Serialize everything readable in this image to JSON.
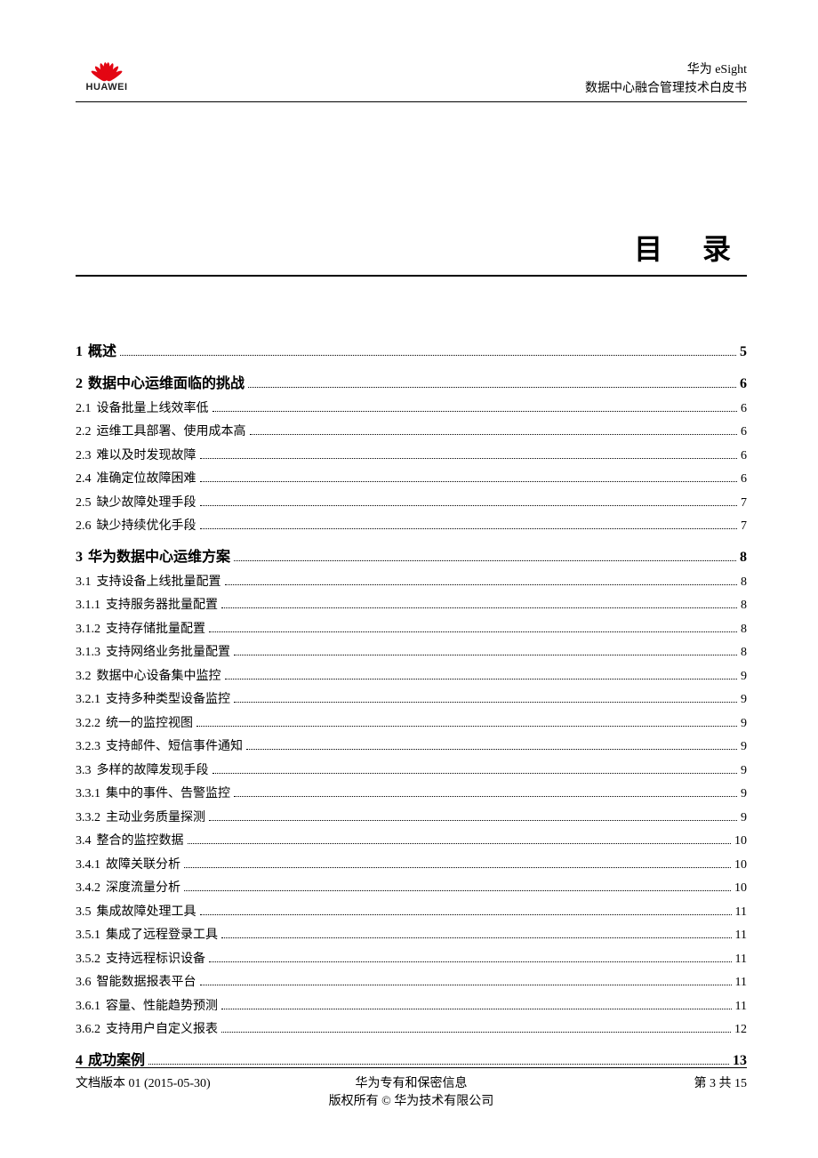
{
  "header": {
    "logo_text": "HUAWEI",
    "line1": "华为 eSight",
    "line2": "数据中心融合管理技术白皮书"
  },
  "title": "目 录",
  "toc": [
    {
      "level": 1,
      "num": "1",
      "label": "概述",
      "page": "5"
    },
    {
      "level": 1,
      "num": "2",
      "label": "数据中心运维面临的挑战",
      "page": "6"
    },
    {
      "level": 2,
      "num": "2.1",
      "label": "设备批量上线效率低",
      "page": "6"
    },
    {
      "level": 2,
      "num": "2.2",
      "label": "运维工具部署、使用成本高",
      "page": "6"
    },
    {
      "level": 2,
      "num": "2.3",
      "label": "难以及时发现故障",
      "page": "6"
    },
    {
      "level": 2,
      "num": "2.4",
      "label": "准确定位故障困难",
      "page": "6"
    },
    {
      "level": 2,
      "num": "2.5",
      "label": "缺少故障处理手段",
      "page": "7"
    },
    {
      "level": 2,
      "num": "2.6",
      "label": "缺少持续优化手段",
      "page": "7"
    },
    {
      "level": 1,
      "num": "3",
      "label": "华为数据中心运维方案",
      "page": "8"
    },
    {
      "level": 2,
      "num": "3.1",
      "label": "支持设备上线批量配置",
      "page": "8"
    },
    {
      "level": 3,
      "num": "3.1.1",
      "label": "支持服务器批量配置",
      "page": "8"
    },
    {
      "level": 3,
      "num": "3.1.2",
      "label": "支持存储批量配置",
      "page": "8"
    },
    {
      "level": 3,
      "num": "3.1.3",
      "label": "支持网络业务批量配置",
      "page": "8"
    },
    {
      "level": 2,
      "num": "3.2",
      "label": "数据中心设备集中监控",
      "page": "9"
    },
    {
      "level": 3,
      "num": "3.2.1",
      "label": "支持多种类型设备监控",
      "page": "9"
    },
    {
      "level": 3,
      "num": "3.2.2",
      "label": "统一的监控视图",
      "page": "9"
    },
    {
      "level": 3,
      "num": "3.2.3",
      "label": "支持邮件、短信事件通知",
      "page": "9"
    },
    {
      "level": 2,
      "num": "3.3",
      "label": "多样的故障发现手段",
      "page": "9"
    },
    {
      "level": 3,
      "num": "3.3.1",
      "label": "集中的事件、告警监控",
      "page": "9"
    },
    {
      "level": 3,
      "num": "3.3.2",
      "label": "主动业务质量探测",
      "page": "9"
    },
    {
      "level": 2,
      "num": "3.4",
      "label": "整合的监控数据",
      "page": "10"
    },
    {
      "level": 3,
      "num": "3.4.1",
      "label": "故障关联分析",
      "page": "10"
    },
    {
      "level": 3,
      "num": "3.4.2",
      "label": "深度流量分析",
      "page": "10"
    },
    {
      "level": 2,
      "num": "3.5",
      "label": "集成故障处理工具",
      "page": "11"
    },
    {
      "level": 3,
      "num": "3.5.1",
      "label": "集成了远程登录工具",
      "page": "11"
    },
    {
      "level": 3,
      "num": "3.5.2",
      "label": "支持远程标识设备",
      "page": "11"
    },
    {
      "level": 2,
      "num": "3.6",
      "label": "智能数据报表平台",
      "page": "11"
    },
    {
      "level": 3,
      "num": "3.6.1",
      "label": "容量、性能趋势预测",
      "page": "11"
    },
    {
      "level": 3,
      "num": "3.6.2",
      "label": "支持用户自定义报表",
      "page": "12"
    },
    {
      "level": 1,
      "num": "4",
      "label": "成功案例",
      "page": "13"
    }
  ],
  "footer": {
    "left": "文档版本 01 (2015-05-30)",
    "center1": "华为专有和保密信息",
    "center2": "版权所有 © 华为技术有限公司",
    "right": "第 3 共 15"
  }
}
